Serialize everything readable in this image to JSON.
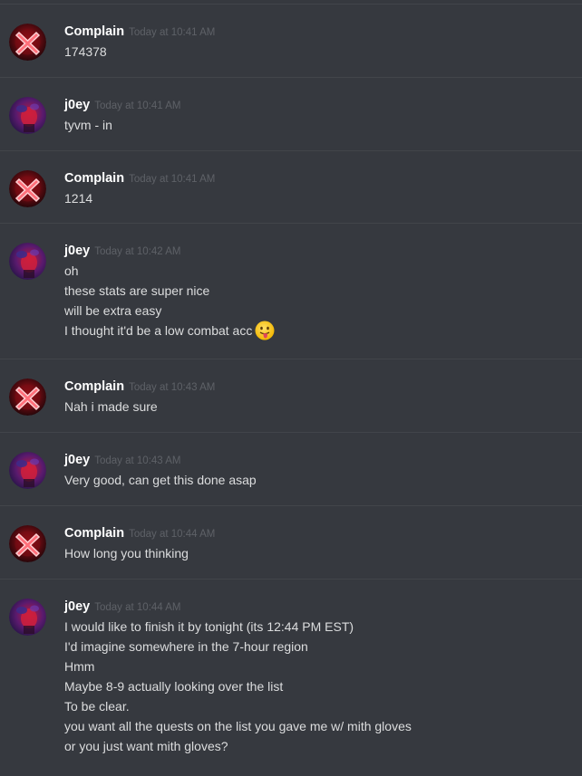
{
  "messages": [
    {
      "author": "Complain",
      "avatar": "complain-avatar",
      "timestamp": "Today at 10:41 AM",
      "lines": [
        {
          "text": "174378"
        }
      ]
    },
    {
      "author": "j0ey",
      "avatar": "joey-avatar",
      "timestamp": "Today at 10:41 AM",
      "lines": [
        {
          "text": "tyvm - in"
        }
      ]
    },
    {
      "author": "Complain",
      "avatar": "complain-avatar",
      "timestamp": "Today at 10:41 AM",
      "lines": [
        {
          "text": "1214"
        }
      ]
    },
    {
      "author": "j0ey",
      "avatar": "joey-avatar",
      "timestamp": "Today at 10:42 AM",
      "lines": [
        {
          "text": "oh"
        },
        {
          "text": "these stats are super nice"
        },
        {
          "text": "will be extra easy"
        },
        {
          "text": "I thought it'd be a low combat acc",
          "emoji": "tongue-out-emoji"
        }
      ]
    },
    {
      "author": "Complain",
      "avatar": "complain-avatar",
      "timestamp": "Today at 10:43 AM",
      "lines": [
        {
          "text": "Nah i made sure"
        }
      ]
    },
    {
      "author": "j0ey",
      "avatar": "joey-avatar",
      "timestamp": "Today at 10:43 AM",
      "lines": [
        {
          "text": "Very good, can get this done asap"
        }
      ]
    },
    {
      "author": "Complain",
      "avatar": "complain-avatar",
      "timestamp": "Today at 10:44 AM",
      "lines": [
        {
          "text": "How long you thinking"
        }
      ]
    },
    {
      "author": "j0ey",
      "avatar": "joey-avatar",
      "timestamp": "Today at 10:44 AM",
      "lines": [
        {
          "text": "I would like to finish it by tonight (its 12:44 PM EST)"
        },
        {
          "text": "I'd imagine somewhere in the 7-hour region"
        },
        {
          "text": "Hmm"
        },
        {
          "text": "Maybe 8-9 actually looking over the list"
        },
        {
          "text": "To be clear."
        },
        {
          "text": "you want all the quests on the list you gave me w/ mith gloves"
        },
        {
          "text": "or you just want mith gloves?"
        }
      ]
    }
  ],
  "colors": {
    "background": "#36393f",
    "divider": "#42454a",
    "username": "#ffffff",
    "timestamp": "#5e6167",
    "message_text": "#dcddde"
  }
}
